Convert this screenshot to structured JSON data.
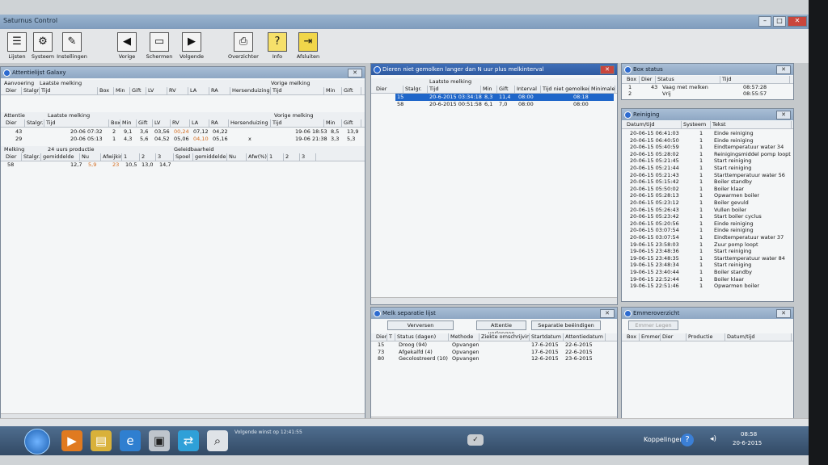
{
  "app": {
    "title": "Saturnus Control"
  },
  "toolbar": [
    {
      "label": "Lijsten",
      "icon": "list-icon"
    },
    {
      "label": "Systeem",
      "icon": "system-icon"
    },
    {
      "label": "Instellingen",
      "icon": "pen-icon"
    },
    {
      "label": "Vorige",
      "icon": "arrow-left-icon"
    },
    {
      "label": "Schermen",
      "icon": "screens-icon"
    },
    {
      "label": "Volgende",
      "icon": "arrow-right-icon"
    },
    {
      "label": "Overzichten",
      "icon": "printer-icon"
    },
    {
      "label": "Info",
      "icon": "help-icon"
    },
    {
      "label": "Afsluiten",
      "icon": "exit-icon"
    }
  ],
  "attention": {
    "title": "Attentielijst Galaxy",
    "section1": {
      "groups": [
        "Aanvoering",
        "Laatste melking",
        "Vorige melking"
      ],
      "headers": [
        "Dier",
        "Stalgr.",
        "Tijd",
        "Box",
        "Min",
        "Gift",
        "LV",
        "RV",
        "LA",
        "RA",
        "Hersenduizing",
        "Tijd",
        "Min",
        "Gift"
      ]
    },
    "section2": {
      "groups": [
        "Attentie",
        "Laatste melking",
        "Vorige melking"
      ],
      "headers": [
        "Dier",
        "Stalgr.",
        "Tijd",
        "Box",
        "Min",
        "Gift",
        "LV",
        "RV",
        "LA",
        "RA",
        "Hersenduizing",
        "Tijd",
        "Min",
        "Gift"
      ],
      "rows": [
        [
          "43",
          "",
          "20-06 07:32",
          "2",
          "9,1",
          "3,6",
          "03,56",
          "00,24",
          "07,12",
          "04,22",
          "",
          "19-06 18:53",
          "8,5",
          "13,9"
        ],
        [
          "29",
          "",
          "20-06 05:13",
          "1",
          "4,3",
          "5,6",
          "04,52",
          "05,06",
          "04,10",
          "05,16",
          "x",
          "19-06 21:38",
          "3,3",
          "5,3"
        ]
      ]
    },
    "section3": {
      "groups": [
        "Melking",
        "24 uurs productie",
        "Geleidbaarheid"
      ],
      "headers": [
        "Dier",
        "Stalgr.",
        "gemiddelde",
        "Nu",
        "Afwijking",
        "1",
        "2",
        "3",
        "Spoel",
        "gemiddelde",
        "Nu",
        "Afw(%)",
        "1",
        "2",
        "3"
      ],
      "row": [
        "58",
        "",
        "12,7",
        "5,9",
        "",
        "23",
        "10,5",
        "13,0",
        "14,7"
      ]
    }
  },
  "notmilked": {
    "title": "Dieren niet gemolken langer dan N uur plus melkinterval",
    "group": "Laatste melking",
    "headers": [
      "Dier",
      "Stalgr.",
      "Tijd",
      "Min",
      "Gift",
      "Interval",
      "Tijd niet gemolken",
      "Minimale"
    ],
    "rows": [
      [
        "15",
        "",
        "20-6-2015 03:34:18",
        "8,3",
        "11,4",
        "08:00",
        "08:18",
        ""
      ],
      [
        "58",
        "",
        "20-6-2015 00:51:58",
        "6,1",
        "7,0",
        "08:00",
        "08:00",
        ""
      ]
    ]
  },
  "boxstatus": {
    "title": "Box status",
    "headers": [
      "Box",
      "Dier",
      "Status",
      "Tijd"
    ],
    "rows": [
      [
        "1",
        "43",
        "Vaag met melken",
        "08:57:28"
      ],
      [
        "2",
        "",
        "Vrij",
        "08:55:57"
      ]
    ]
  },
  "cleaning": {
    "title": "Reiniging",
    "headers": [
      "Datum/tijd",
      "Systeem",
      "Tekst"
    ],
    "rows": [
      [
        "20-06-15 06:41:03",
        "1",
        "Einde reiniging"
      ],
      [
        "20-06-15 06:40:50",
        "1",
        "Einde reiniging"
      ],
      [
        "20-06-15 05:40:59",
        "1",
        "Eindtemperatuur water 34"
      ],
      [
        "20-06-15 05:28:02",
        "1",
        "Reinigingsmiddel pomp loopt"
      ],
      [
        "20-06-15 05:21:45",
        "1",
        "Start reiniging"
      ],
      [
        "20-06-15 05:21:44",
        "1",
        "Start reiniging"
      ],
      [
        "20-06-15 05:21:43",
        "1",
        "Starttemperatuur water 56"
      ],
      [
        "20-06-15 05:15:42",
        "1",
        "Boiler standby"
      ],
      [
        "20-06-15 05:50:02",
        "1",
        "Boiler klaar"
      ],
      [
        "20-06-15 05:28:13",
        "1",
        "Opwarmen boiler"
      ],
      [
        "20-06-15 05:23:12",
        "1",
        "Boiler gevuld"
      ],
      [
        "20-06-15 05:26:43",
        "1",
        "Vullen boiler"
      ],
      [
        "20-06-15 05:23:42",
        "1",
        "Start boiler cyclus"
      ],
      [
        "20-06-15 05:20:56",
        "1",
        "Einde reiniging"
      ],
      [
        "20-06-15 03:07:54",
        "1",
        "Einde reiniging"
      ],
      [
        "20-06-15 03:07:54",
        "1",
        "Eindtemperatuur water 37"
      ],
      [
        "19-06-15 23:58:03",
        "1",
        "Zuur pomp loopt"
      ],
      [
        "19-06-15 23:48:36",
        "1",
        "Start reiniging"
      ],
      [
        "19-06-15 23:48:35",
        "1",
        "Starttemperatuur water 84"
      ],
      [
        "19-06-15 23:48:34",
        "1",
        "Start reiniging"
      ],
      [
        "19-06-15 23:40:44",
        "1",
        "Boiler standby"
      ],
      [
        "19-06-15 22:52:44",
        "1",
        "Boiler klaar"
      ],
      [
        "19-06-15 22:51:46",
        "1",
        "Opwarmen boiler"
      ]
    ]
  },
  "separate": {
    "title": "Melk separatie lijst",
    "buttons": [
      "Verversen",
      "Attentie verlengen",
      "Separatie beëindigen"
    ],
    "headers": [
      "Dier",
      "T",
      "Status (dagen)",
      "Methode",
      "Ziekte omschrijving",
      "Startdatum",
      "Attentiedatum"
    ],
    "rows": [
      [
        "15",
        "",
        "Droog (94)",
        "Opvangen",
        "",
        "17-6-2015",
        "22-6-2015"
      ],
      [
        "73",
        "",
        "Afgekalfd (4)",
        "Opvangen",
        "",
        "17-6-2015",
        "22-6-2015"
      ],
      [
        "80",
        "",
        "Gecolostreerd (10)",
        "Opvangen",
        "",
        "12-6-2015",
        "23-6-2015"
      ]
    ]
  },
  "buckets": {
    "title": "Emmeroverzicht",
    "button": "Emmer Legen",
    "headers": [
      "Box",
      "Emmer",
      "Dier",
      "Productie",
      "Datum/tijd"
    ]
  },
  "statusline": {
    "text": "Volgende winst op 12:41:55"
  },
  "taskbar": {
    "tray_label": "Koppelingen",
    "time": "08:58",
    "date": "20-6-2015"
  }
}
